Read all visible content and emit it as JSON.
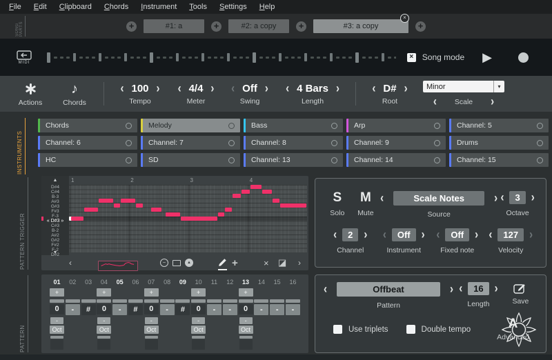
{
  "menu": {
    "items": [
      "File",
      "Edit",
      "Clipboard",
      "Chords",
      "Instrument",
      "Tools",
      "Settings",
      "Help"
    ]
  },
  "tabs": {
    "side_label": "SONG PARTS",
    "add_label": "+",
    "items": [
      {
        "label": "#1: a",
        "active": false
      },
      {
        "label": "#2: a copy",
        "active": false
      },
      {
        "label": "#3: a copy",
        "active": true
      }
    ]
  },
  "transport": {
    "midi_label": "MIDI",
    "song_mode_label": "Song mode",
    "song_mode_checked": true,
    "timeline": {
      "markers": 17,
      "dashes_between": 3
    }
  },
  "toolbar": {
    "actions_label": "Actions",
    "chords_label": "Chords",
    "tempo": {
      "value": "100",
      "label": "Tempo"
    },
    "meter": {
      "value": "4/4",
      "label": "Meter"
    },
    "swing": {
      "value": "Off",
      "label": "Swing"
    },
    "length": {
      "value": "4 Bars",
      "label": "Length"
    },
    "root": {
      "value": "D#",
      "label": "Root"
    },
    "scale": {
      "value": "Minor",
      "label": "Scale"
    }
  },
  "sections": {
    "instruments": "INSTRUMENTS",
    "pattern_trigger": "PATTERN TRIGGER",
    "pattern": "PATTERN"
  },
  "instruments": {
    "rows": [
      [
        {
          "name": "Chords",
          "color": "#52b84c"
        },
        {
          "name": "Melody",
          "color": "#d9cf3e",
          "selected": true
        },
        {
          "name": "Bass",
          "color": "#35c5f0"
        },
        {
          "name": "Arp",
          "color": "#d356dd"
        },
        {
          "name": "Channel: 5",
          "color": "#5a7bf7"
        }
      ],
      [
        {
          "name": "Channel: 6",
          "color": "#5a7bf7"
        },
        {
          "name": "Channel: 7",
          "color": "#5a7bf7"
        },
        {
          "name": "Channel: 8",
          "color": "#5a7bf7"
        },
        {
          "name": "Channel: 9",
          "color": "#5a7bf7"
        },
        {
          "name": "Drums",
          "color": "#5a7bf7"
        }
      ],
      [
        {
          "name": "HC",
          "color": "#5a7bf7"
        },
        {
          "name": "SD",
          "color": "#5a7bf7"
        },
        {
          "name": "Channel: 13",
          "color": "#5a7bf7"
        },
        {
          "name": "Channel: 14",
          "color": "#5a7bf7"
        },
        {
          "name": "Channel: 15",
          "color": "#5a7bf7"
        }
      ]
    ]
  },
  "pianoroll": {
    "bar_numbers": [
      "1",
      "2",
      "3",
      "4"
    ],
    "note_rows": [
      "D#4",
      "C#4",
      "B-3",
      "A#3",
      "G#3",
      "F#3",
      "F-3",
      "« D#3 »",
      "C#3",
      "B-2",
      "A#2",
      "G#2",
      "F#2",
      "F-2",
      "D#2"
    ],
    "selected_row_index": 7,
    "note_color": "#ef3169",
    "beats": 16,
    "notes": [
      {
        "row": 7,
        "start": 0,
        "len": 1,
        "cap": true
      },
      {
        "row": 5,
        "start": 1,
        "len": 1
      },
      {
        "row": 3,
        "start": 2,
        "len": 1
      },
      {
        "row": 4,
        "start": 3,
        "len": 0.5
      },
      {
        "row": 3,
        "start": 3.5,
        "len": 1
      },
      {
        "row": 4,
        "start": 4.5,
        "len": 0.5
      },
      {
        "row": 5,
        "start": 5.5,
        "len": 0.75
      },
      {
        "row": 6,
        "start": 6.5,
        "len": 1
      },
      {
        "row": 7,
        "start": 7.5,
        "len": 2.5
      },
      {
        "row": 6,
        "start": 10,
        "len": 0.5
      },
      {
        "row": 5,
        "start": 10.5,
        "len": 0.5
      },
      {
        "row": 2,
        "start": 11,
        "len": 0.6
      },
      {
        "row": 1,
        "start": 11.6,
        "len": 0.6
      },
      {
        "row": 0,
        "start": 12.2,
        "len": 0.8
      },
      {
        "row": 1,
        "start": 13,
        "len": 0.7
      },
      {
        "row": 3,
        "start": 13.7,
        "len": 0.5
      },
      {
        "row": 4,
        "start": 14.2,
        "len": 1.8
      }
    ]
  },
  "track_props": {
    "solo": {
      "icon": "S",
      "label": "Solo"
    },
    "mute": {
      "icon": "M",
      "label": "Mute"
    },
    "source": {
      "value": "Scale Notes",
      "label": "Source"
    },
    "octave": {
      "value": "3",
      "label": "Octave"
    },
    "channel": {
      "value": "2",
      "label": "Channel"
    },
    "instrument": {
      "value": "Off",
      "label": "Instrument"
    },
    "fixed_note": {
      "value": "Off",
      "label": "Fixed note"
    },
    "velocity": {
      "value": "127",
      "label": "Velocity"
    }
  },
  "step_seq": {
    "headers": [
      "01",
      "02",
      "03",
      "04",
      "05",
      "06",
      "07",
      "08",
      "09",
      "10",
      "11",
      "12",
      "13",
      "14",
      "15",
      "16"
    ],
    "bold_headers": [
      0,
      4,
      8,
      12
    ],
    "values": [
      "0",
      "-",
      "#",
      "0",
      "-",
      "#",
      "0",
      "-",
      "#",
      "0",
      "-",
      "-",
      "0",
      "-",
      "-",
      "-"
    ],
    "dark_values": [
      0,
      2,
      3,
      5,
      6,
      8,
      9,
      12
    ],
    "control_cols": [
      0,
      3,
      6,
      9,
      12
    ],
    "plus_label": "+",
    "minus_label": "-",
    "oct_label": "Oct"
  },
  "pattern_panel": {
    "pattern": {
      "value": "Offbeat",
      "label": "Pattern"
    },
    "length": {
      "value": "16",
      "label": "Length"
    },
    "save_label": "Save",
    "use_triplets": {
      "label": "Use triplets",
      "checked": false
    },
    "double_tempo": {
      "label": "Double tempo",
      "checked": false
    },
    "advanced": {
      "icon": "A",
      "label": "Advanced"
    }
  },
  "icons": {
    "chevron_left": "‹",
    "chevron_right": "›",
    "play": "▶",
    "record_dot": "",
    "scroll_up": "▲",
    "scroll_down": "▼",
    "close": "×",
    "checkbox_check": "×",
    "dropdown_caret": "▾",
    "eighth_note": "♪",
    "minus_circle": "−",
    "arrow_up_circle": "▲",
    "move_cross": "+",
    "delete_x": "×",
    "contrast_square": "◪"
  }
}
